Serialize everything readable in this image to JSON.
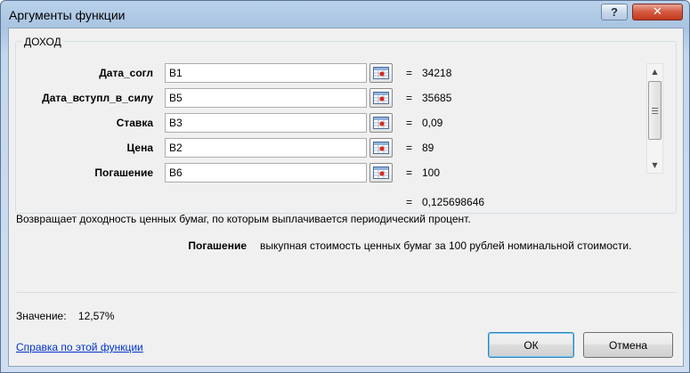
{
  "window": {
    "title": "Аргументы функции",
    "help_glyph": "?",
    "close_glyph": "✕"
  },
  "function": {
    "name": "ДОХОД",
    "args": [
      {
        "label": "Дата_согл",
        "input": "B1",
        "value": "34218"
      },
      {
        "label": "Дата_вступл_в_силу",
        "input": "B5",
        "value": "35685"
      },
      {
        "label": "Ставка",
        "input": "B3",
        "value": "0,09"
      },
      {
        "label": "Цена",
        "input": "B2",
        "value": "89"
      },
      {
        "label": "Погашение",
        "input": "B6",
        "value": "100"
      }
    ],
    "eq_sign": "=",
    "result": "0,125698646",
    "description": "Возвращает доходность ценных бумаг, по которым выплачивается периодический процент.",
    "arg_help_name": "Погашение",
    "arg_help_text": "выкупная стоимость ценных бумаг за 100 рублей номинальной стоимости."
  },
  "footer": {
    "value_label": "Значение:",
    "value": "12,57%",
    "help_link": "Справка по этой функции",
    "ok_label": "ОК",
    "cancel_label": "Отмена"
  },
  "icons": {
    "ref_button": "range-select-icon",
    "scroll_up": "arrow-up-icon",
    "scroll_down": "arrow-down-icon"
  },
  "colors": {
    "link": "#0033cc",
    "close_button": "#c23a20",
    "title_bar": "#b9d1ea"
  }
}
